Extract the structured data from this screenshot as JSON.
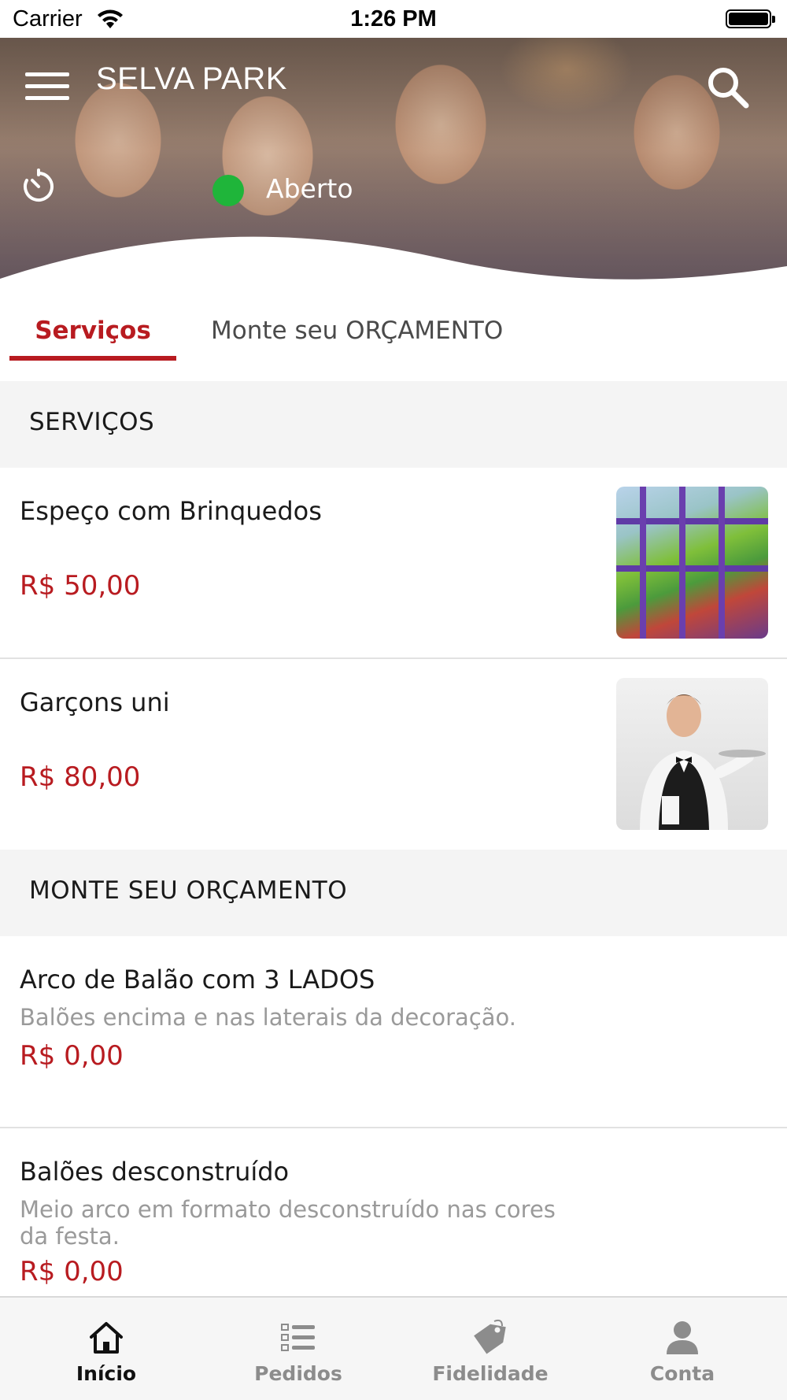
{
  "status_bar": {
    "carrier": "Carrier",
    "time": "1:26 PM"
  },
  "header": {
    "title": "SELVA PARK",
    "store_status": "Aberto"
  },
  "tabs": [
    {
      "label": "Serviços",
      "active": true
    },
    {
      "label": "Monte seu ORÇAMENTO",
      "active": false
    }
  ],
  "sections": [
    {
      "title": "SERVIÇOS",
      "items": [
        {
          "name": "Espeço com Brinquedos",
          "price": "R$ 50,00",
          "image": "playground-photo"
        },
        {
          "name": "Garçons  uni",
          "price": "R$ 80,00",
          "image": "waiter-photo"
        }
      ]
    },
    {
      "title": "MONTE SEU ORÇAMENTO",
      "items": [
        {
          "name": "Arco de Balão com 3 LADOS",
          "description": "Balões encima e nas laterais da decoração.",
          "price": "R$ 0,00"
        },
        {
          "name": "Balões desconstruído",
          "description": "Meio arco em formato desconstruído nas cores da festa.",
          "price": "R$ 0,00"
        }
      ]
    }
  ],
  "bottom_nav": [
    {
      "label": "Início",
      "icon": "home-icon",
      "active": true
    },
    {
      "label": "Pedidos",
      "icon": "orders-list-icon",
      "active": false
    },
    {
      "label": "Fidelidade",
      "icon": "loyalty-tag-icon",
      "active": false
    },
    {
      "label": "Conta",
      "icon": "account-user-icon",
      "active": false
    }
  ],
  "colors": {
    "accent": "#b81b20",
    "open_indicator": "#1fb53a",
    "section_bg": "#f4f4f4"
  }
}
